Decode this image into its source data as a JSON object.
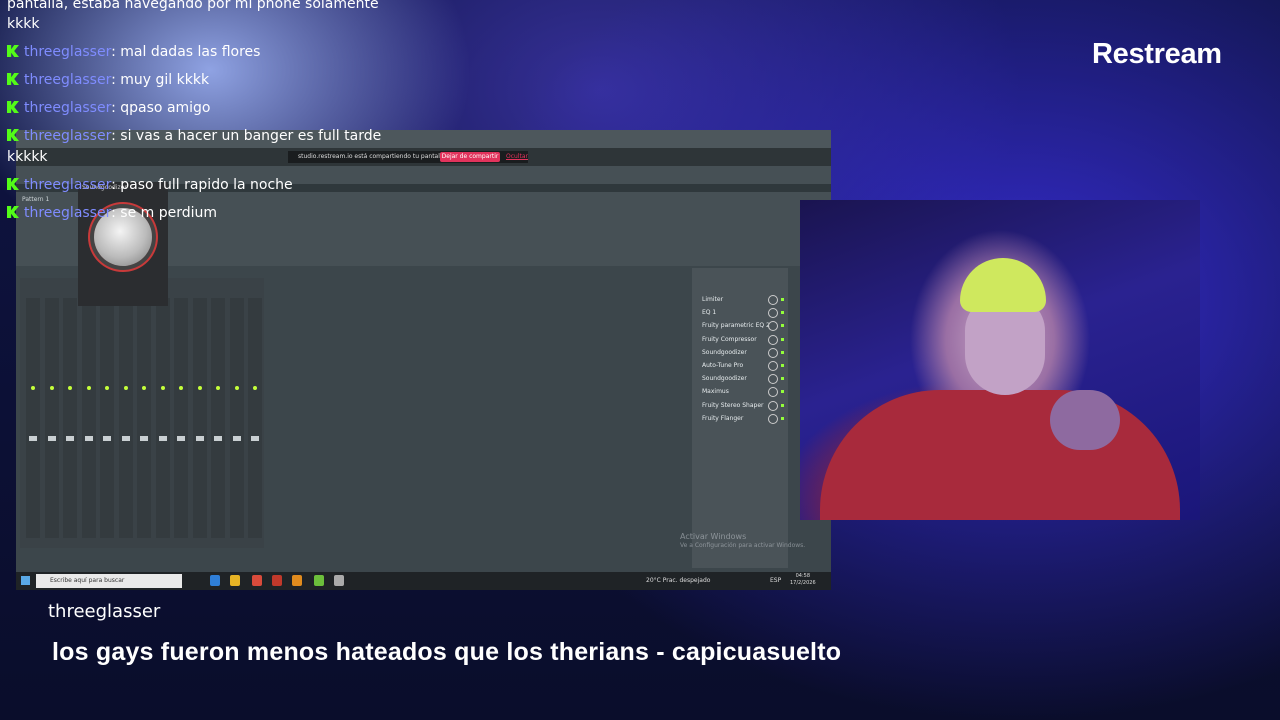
{
  "brand": {
    "name": "Restream"
  },
  "chat": {
    "partial_line_1": "pantalla, estaba navegando por mi phone solamente",
    "partial_line_2": "kkkk",
    "messages": [
      {
        "user": "threeglasser",
        "text": "mal dadas las flores"
      },
      {
        "user": "threeglasser",
        "text": "muy gil kkkk"
      },
      {
        "user": "threeglasser",
        "text": "qpaso amigo"
      },
      {
        "user": "threeglasser",
        "text": "si vas a hacer un banger es full tarde",
        "cont": "kkkkk"
      },
      {
        "user": "threeglasser",
        "text": "paso full rapido la noche"
      },
      {
        "user": "threeglasser",
        "text": "se m perdium"
      }
    ],
    "accent_user": "#7f8cff",
    "accent_platform": "#53fc18"
  },
  "screen": {
    "notification_text": "studio.restream.io está compartiendo tu pantalla y audio.",
    "notification_stop": "Dejar de compartir",
    "notification_hide": "Ocultar",
    "plugin_title": "Soundgoodizer",
    "pattern": "Pattern 1",
    "fx_chain": [
      "Limiter",
      "EQ 1",
      "Fruity parametric EQ 2",
      "Fruity Compressor",
      "Soundgoodizer",
      "Auto-Tune Pro",
      "Soundgoodizer",
      "Maximus",
      "Fruity Stereo Shaper",
      "Fruity Flanger"
    ],
    "activate_windows": [
      "Activar Windows",
      "Ve a Configuración para activar Windows."
    ],
    "taskbar_search": "Escribe aquí para buscar",
    "weather": "20°C  Prac. despejado",
    "lang": "ESP",
    "clock_time": "04:58",
    "clock_date": "17/2/2026"
  },
  "caption": {
    "user": "threeglasser",
    "message": "los gays fueron menos hateados que los therians - capicuasuelto"
  }
}
